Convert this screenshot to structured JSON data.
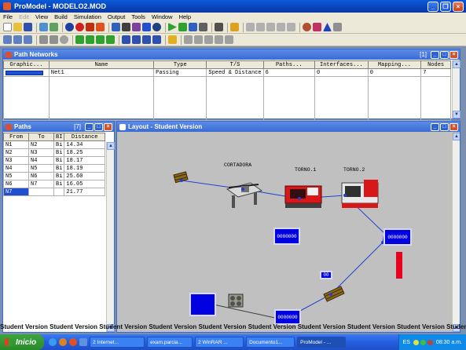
{
  "app": {
    "title": "ProModel - MODELO2.MOD"
  },
  "menu": [
    "File",
    "Edit",
    "View",
    "Build",
    "Simulation",
    "Output",
    "Tools",
    "Window",
    "Help"
  ],
  "path_networks": {
    "title": "Path Networks",
    "indicator": "[1]",
    "columns": [
      "Graphic...",
      "Name",
      "Type",
      "T/S",
      "Paths...",
      "Interfaces...",
      "Mapping...",
      "Nodes"
    ],
    "row": {
      "name": "Net1",
      "type": "Passing",
      "ts": "Speed & Distance",
      "paths": "6",
      "interfaces": "0",
      "mapping": "0",
      "nodes": "7"
    }
  },
  "paths": {
    "title": "Paths",
    "indicator": "[7]",
    "columns": [
      "From",
      "To",
      "BI",
      "Distance"
    ],
    "rows": [
      [
        "N1",
        "N2",
        "Bi",
        "14.34"
      ],
      [
        "N2",
        "N3",
        "Bi",
        "18.25"
      ],
      [
        "N3",
        "N4",
        "Bi",
        "18.17"
      ],
      [
        "N4",
        "N5",
        "Bi",
        "18.19"
      ],
      [
        "N5",
        "N6",
        "Bi",
        "25.60"
      ],
      [
        "N6",
        "N7",
        "Bi",
        "16.05"
      ],
      [
        "N7",
        "",
        "",
        "21.77"
      ]
    ]
  },
  "layout": {
    "title": "Layout - Student Version",
    "labels": {
      "cortadora": "CORTADORA",
      "torno1": "TORNO.1",
      "torno2": "TORNO.2"
    },
    "counters": {
      "c1": "0000000",
      "c2": "0000000",
      "c3": "0000000",
      "c4": "00"
    }
  },
  "watermark": "Student Version Student Version Student Version Student Version Student Version Student Version Student Version Student Version Student Version Student Version",
  "taskbar": {
    "start": "Inicio",
    "tasks": [
      "2 Internet...",
      "exam.parcia...",
      "2 WinRAR ...",
      "Documento1...",
      "ProModel - ..."
    ],
    "lang": "ES",
    "time": "08:30 a.m."
  },
  "colors": {
    "accent": "#0a5bd8",
    "counter": "#0000e0",
    "path": "#1f3fd0",
    "red_bar": "#e8001c"
  }
}
